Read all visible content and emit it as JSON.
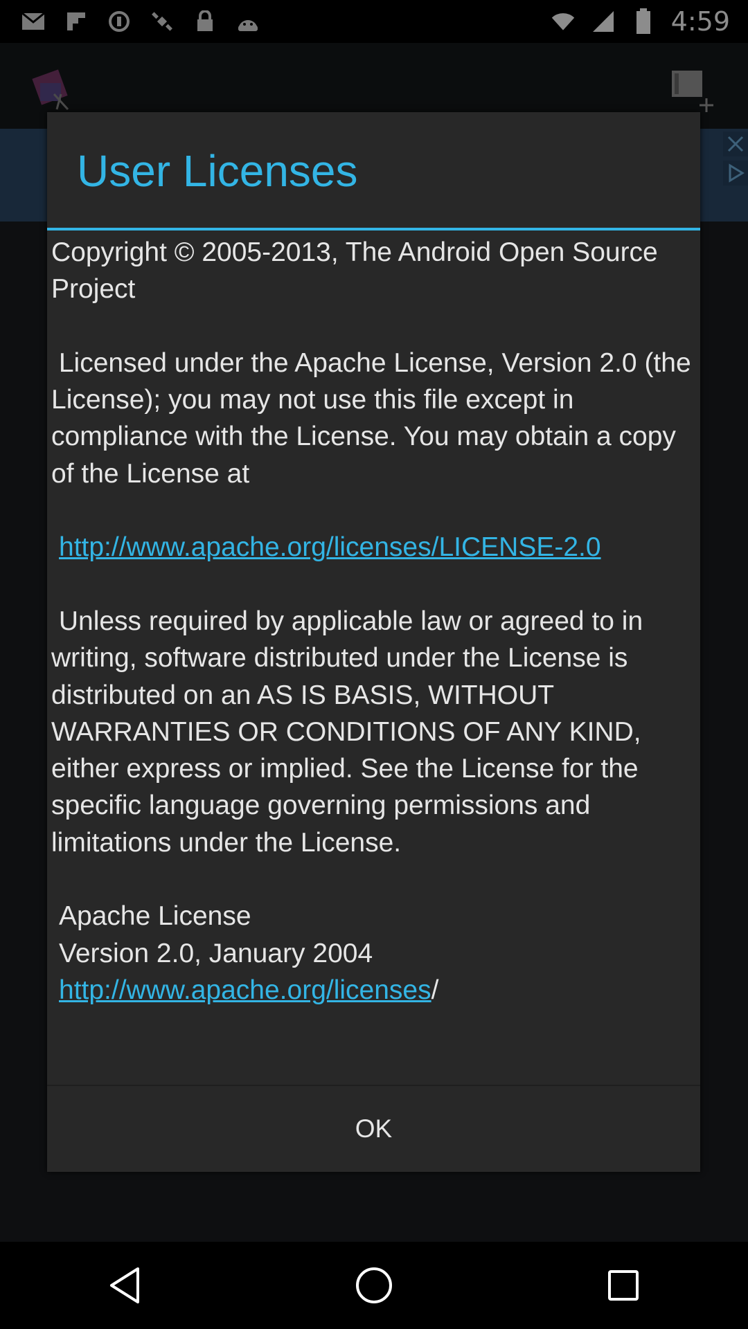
{
  "status_bar": {
    "time": "4:59",
    "left_icons": [
      "mail-icon",
      "flipboard-icon",
      "circle-icon",
      "satellite-icon",
      "lock-icon",
      "android-icon"
    ],
    "right_icons": [
      "wifi-icon",
      "signal-icon",
      "battery-icon"
    ]
  },
  "background_app": {
    "toolbar_icons": [
      "app-logo-icon",
      "add-video-icon"
    ],
    "ad_icons": [
      "close-icon",
      "play-icon"
    ]
  },
  "dialog": {
    "title": "User Licenses",
    "paragraphs": [
      "Copyright © 2005-2013, The Android Open Source Project",
      " Licensed under the Apache License, Version 2.0 (the License); you may not use this file except in compliance with the License. You may obtain a copy of the License at",
      "http://www.apache.org/licenses/LICENSE-2.0",
      " Unless required by applicable law or agreed to in writing, software distributed under the License is distributed on an AS IS BASIS, WITHOUT WARRANTIES OR CONDITIONS OF ANY KIND, either express or implied. See the License for the specific language governing permissions and limitations under the License.",
      "Apache License",
      "Version 2.0, January 2004",
      "http://www.apache.org/licenses",
      "/"
    ],
    "ok_label": "OK"
  },
  "nav_bar": {
    "buttons": [
      "back-icon",
      "home-icon",
      "recents-icon"
    ]
  },
  "colors": {
    "accent": "#33b5e5",
    "dialog_bg": "#282828",
    "text": "#e6e6e6"
  }
}
